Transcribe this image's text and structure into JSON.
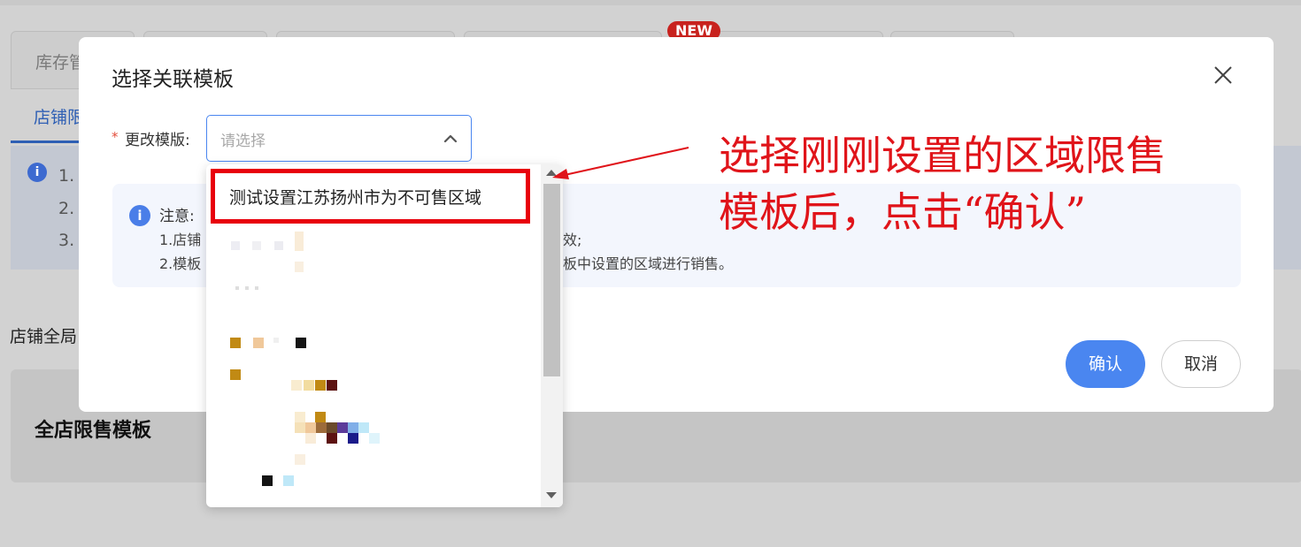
{
  "background": {
    "tabs": [
      "库存管"
    ],
    "new_badge": "NEW",
    "subtab": "店铺限",
    "notice_items": [
      "1.",
      "2.",
      "3."
    ],
    "section_title": "店铺全局",
    "card_title": "全店限售模板"
  },
  "modal": {
    "title": "选择关联模板",
    "field": {
      "required_mark": "*",
      "label": "更改模版:",
      "placeholder": "请选择"
    },
    "notice": {
      "title": "注意:",
      "lines": [
        {
          "start": "1.店铺",
          "end": "效;"
        },
        {
          "start": "2.模板",
          "end": "板中设置的区域进行销售。"
        }
      ]
    },
    "confirm_label": "确认",
    "cancel_label": "取消"
  },
  "dropdown": {
    "options": [
      "测试设置江苏扬州市为不可售区域"
    ]
  },
  "annotation": {
    "line1": "选择刚刚设置的区域限售",
    "line2": "模板后，点击“确认”",
    "color": "#e0141a"
  },
  "colors": {
    "primary": "#4a86f0",
    "highlight_border": "#e8000b"
  }
}
